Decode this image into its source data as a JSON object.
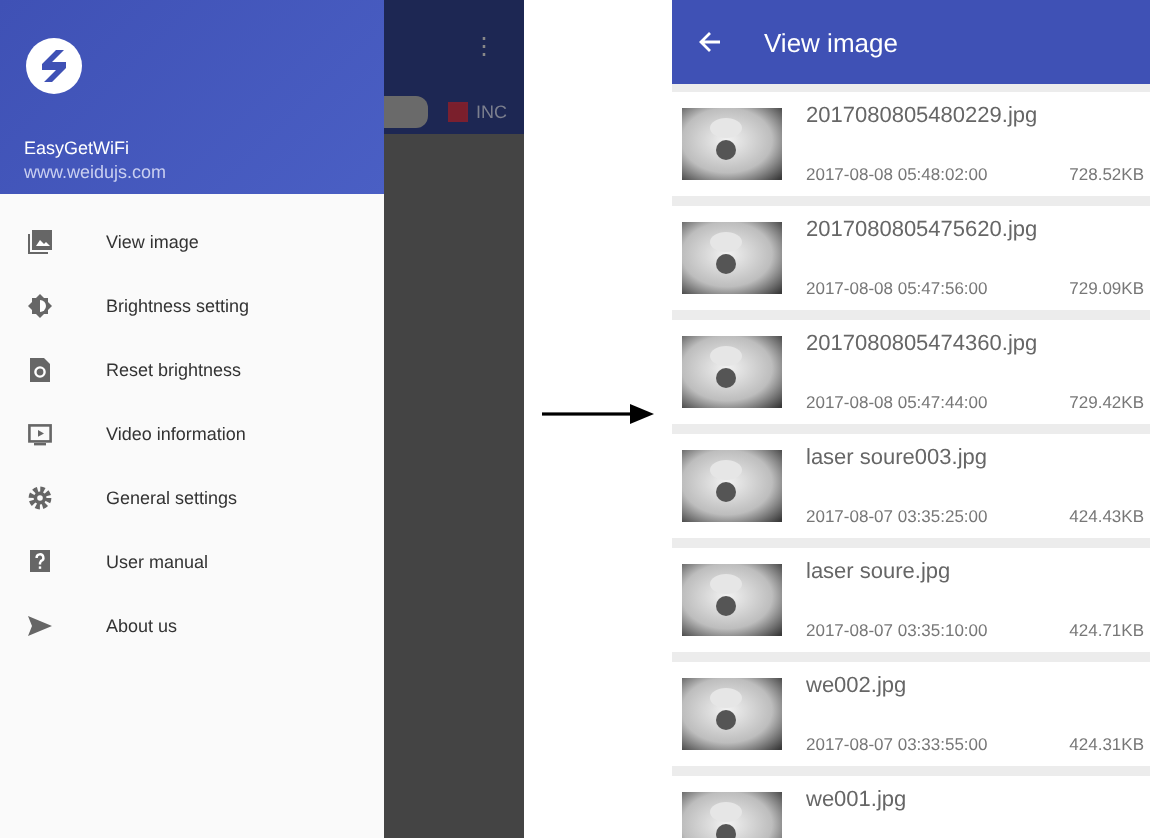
{
  "left_screen": {
    "drawer": {
      "app_name": "EasyGetWiFi",
      "url": "www.weidujs.com",
      "items": [
        {
          "label": "View image"
        },
        {
          "label": "Brightness setting"
        },
        {
          "label": "Reset brightness"
        },
        {
          "label": "Video information"
        },
        {
          "label": "General settings"
        },
        {
          "label": "User manual"
        },
        {
          "label": "About us"
        }
      ]
    },
    "background": {
      "overflow_menu": "⋮",
      "checkbox": {
        "label": "INC",
        "checked": true
      }
    }
  },
  "right_screen": {
    "title": "View image",
    "files": [
      {
        "name": "2017080805480229.jpg",
        "date": "2017-08-08 05:48:02:00",
        "size": "728.52KB"
      },
      {
        "name": "2017080805475620.jpg",
        "date": "2017-08-08 05:47:56:00",
        "size": "729.09KB"
      },
      {
        "name": "2017080805474360.jpg",
        "date": "2017-08-08 05:47:44:00",
        "size": "729.42KB"
      },
      {
        "name": "laser soure003.jpg",
        "date": "2017-08-07 03:35:25:00",
        "size": "424.43KB"
      },
      {
        "name": "laser soure.jpg",
        "date": "2017-08-07 03:35:10:00",
        "size": "424.71KB"
      },
      {
        "name": "we002.jpg",
        "date": "2017-08-07 03:33:55:00",
        "size": "424.31KB"
      },
      {
        "name": "we001.jpg"
      }
    ]
  }
}
